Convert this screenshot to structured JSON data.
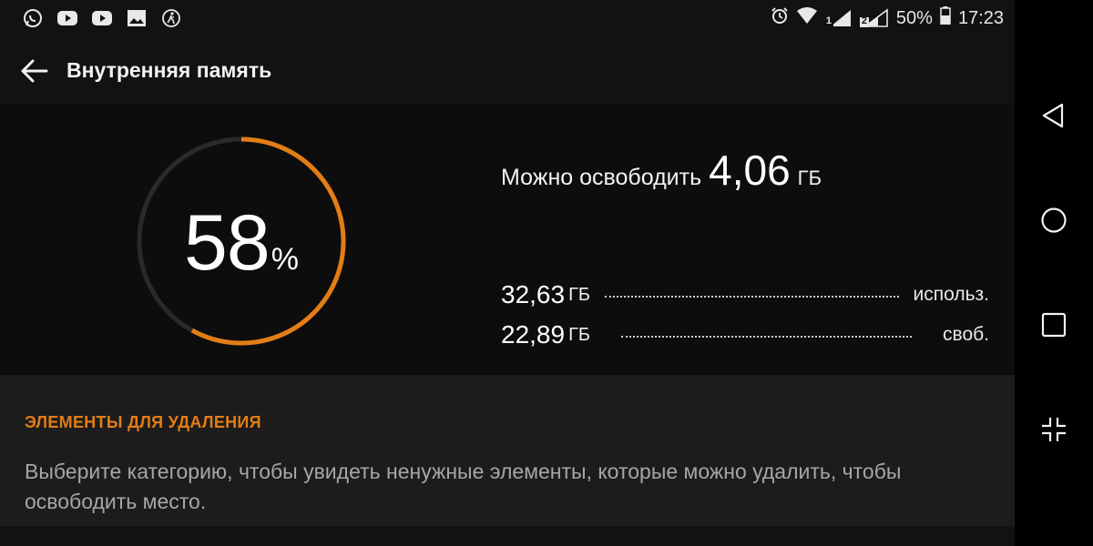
{
  "status_bar": {
    "notification_icons": [
      "whatsapp-icon",
      "youtube-icon",
      "youtube-icon",
      "gallery-icon",
      "fitness-icon"
    ],
    "battery": "50%",
    "time": "17:23",
    "sim1_label": "1",
    "sim2_label": "2"
  },
  "header": {
    "title": "Внутренняя память"
  },
  "storage": {
    "used_percent": 58,
    "percent_symbol": "%",
    "free_label": "Можно освободить",
    "free_value": "4,06",
    "free_unit": "ГБ",
    "used_amount": "32,63",
    "used_unit": "ГБ",
    "used_caption": "использ.",
    "available_amount": "22,89",
    "available_unit": "ГБ",
    "available_caption": "своб."
  },
  "cleanup_section": {
    "title": "ЭЛЕМЕНТЫ ДЛЯ УДАЛЕНИЯ",
    "description": "Выберите категорию, чтобы увидеть ненужные элементы, которые можно удалить, чтобы освободить место."
  },
  "navigation": {
    "buttons": [
      "back-icon",
      "home-icon",
      "recents-icon",
      "collapse-icon"
    ]
  },
  "colors": {
    "accent": "#e37d16",
    "ring_track": "#2a2a2a",
    "background": "#121212"
  }
}
